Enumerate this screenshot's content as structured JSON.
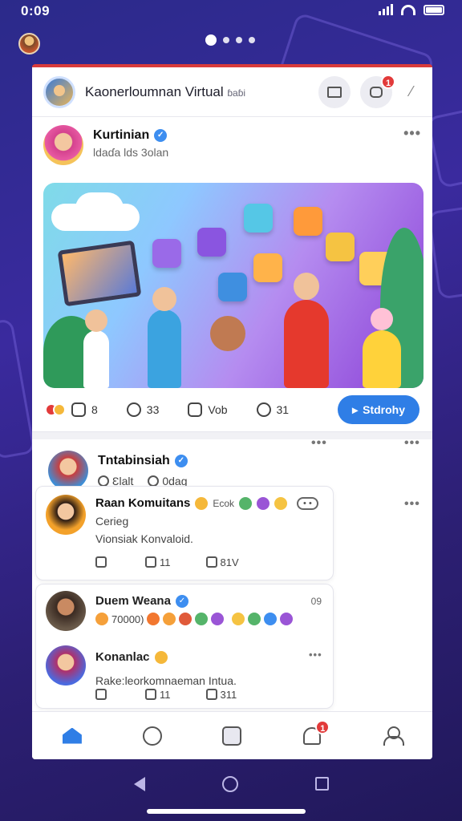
{
  "status_bar": {
    "time": "0:09"
  },
  "app": {
    "title": "Kaonerloumnan Virtual",
    "title_suffix": "ɓaɓi",
    "notif_count": "1"
  },
  "post": {
    "author": "Kurtinian",
    "subtitle": "Ɩdaɗa lds 3olan",
    "actions": {
      "likes": "8",
      "comments": "33",
      "views": "Vob",
      "shares": "31",
      "promote_label": "Stdrohy"
    }
  },
  "post2": {
    "author": "Tntabinsiah",
    "meta1": "Ɛlalt",
    "meta2": "0dag"
  },
  "comments": [
    {
      "author": "Raan Komuitans",
      "tag_text": "Εcok",
      "line1": "Cerieg",
      "line2": "Vionsiak Konvaloid.",
      "acts": [
        "",
        "11",
        "81V"
      ]
    },
    {
      "author": "Duem Weana",
      "time": "09",
      "line1": "70000)",
      "acts": []
    },
    {
      "author": "Konanlac",
      "line1": "Rake:leorkomnaeman Intua.",
      "acts": [
        "",
        "11",
        "311"
      ]
    }
  ],
  "bottom_nav": {
    "notif_count": "1"
  },
  "colors": {
    "brand_blue": "#2f7ee6",
    "badge_red": "#e23a3a",
    "background": "#2b2a8a"
  }
}
